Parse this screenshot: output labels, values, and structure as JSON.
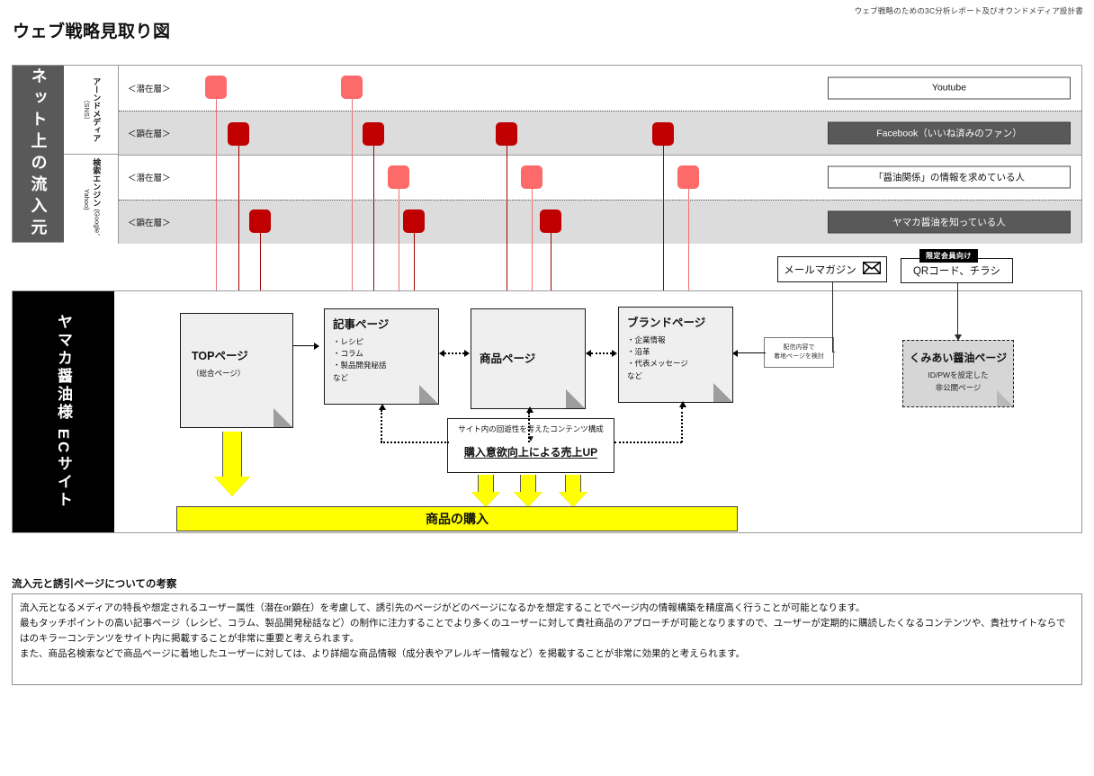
{
  "header": {
    "doc_subtitle": "ウェブ戦略のための3C分析レポート及びオウンドメディア設計書",
    "title": "ウェブ戦略見取り図"
  },
  "inflow": {
    "band_label": "ネット上の流入元",
    "categories": [
      {
        "name": "アーンドメディア",
        "sub": "（SNS）"
      },
      {
        "name": "検索エンジン",
        "sub": "(Google、Yahoo)"
      }
    ],
    "rows": [
      {
        "layer": "＜潜在層＞",
        "channel": "Youtube",
        "style": "light"
      },
      {
        "layer": "＜顕在層＞",
        "channel": "Facebook（いいね済みのファン）",
        "style": "dark"
      },
      {
        "layer": "＜潜在層＞",
        "channel": "「醤油関係」の情報を求めている人",
        "style": "light"
      },
      {
        "layer": "＜顕在層＞",
        "channel": "ヤマカ醤油を知っている人",
        "style": "dark"
      }
    ],
    "colors": {
      "latent": "#fd6a6a",
      "actual": "#c00000",
      "band": "#595959",
      "shade_row": "#dcdcdc"
    }
  },
  "ecsite": {
    "band_label": "ヤマカ醤油様 ECサイト",
    "pages": [
      {
        "title": "TOPページ",
        "lines": [
          "（総合ページ）"
        ]
      },
      {
        "title": "記事ページ",
        "lines": [
          "・レシピ",
          "・コラム",
          "・製品開発秘話",
          "など"
        ]
      },
      {
        "title": "商品ページ",
        "lines": []
      },
      {
        "title": "ブランドページ",
        "lines": [
          "・企業情報",
          "・沿革",
          "・代表メッセージ",
          "など"
        ]
      }
    ],
    "loop_box": {
      "line1": "サイト内の回遊性を考えたコンテンツ構成",
      "triangle": "▼",
      "line2": "購入意欲向上による売上UP"
    },
    "purchase_bar": "商品の購入",
    "mailmag": {
      "label": "メールマガジン",
      "icon": "envelope-icon"
    },
    "qr": {
      "badge": "限定会員向け",
      "label": "QRコード、チラシ"
    },
    "memo": {
      "line1": "配信内容で",
      "line2": "着地ページを検討"
    },
    "secret_page": {
      "title": "くみあい醤油ページ",
      "sub1": "ID/PWを設定した",
      "sub2": "非公開ページ"
    },
    "colors": {
      "yellow": "#ffff00",
      "band": "#000000",
      "card": "#efefef",
      "secret": "#d6d6d6"
    }
  },
  "note": {
    "title": "流入元と誘引ページについての考察",
    "paragraphs": [
      "流入元となるメディアの特長や想定されるユーザー属性（潜在or顕在）を考慮して、誘引先のページがどのページになるかを想定することでページ内の情報構築を精度高く行うことが可能となります。",
      "最もタッチポイントの高い記事ページ（レシピ、コラム、製品開発秘話など）の制作に注力することでより多くのユーザーに対して貴社商品のアプローチが可能となりますので、ユーザーが定期的に購読したくなるコンテンツや、貴社サイトならではのキラーコンテンツをサイト内に掲載することが非常に重要と考えられます。",
      "また、商品名検索などで商品ページに着地したユーザーに対しては、より詳細な商品情報（成分表やアレルギー情報など）を掲載することが非常に効果的と考えられます。"
    ]
  }
}
